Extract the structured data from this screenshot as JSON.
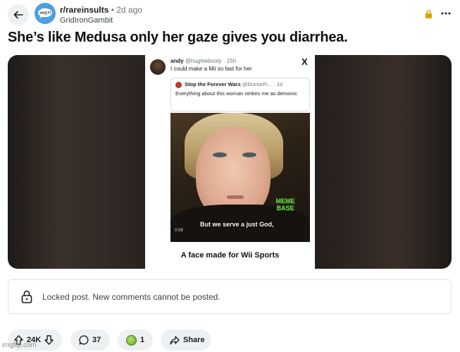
{
  "header": {
    "subreddit": "r/rareinsults",
    "time_ago": "• 2d ago",
    "username": "GridIronGambit",
    "avatar_text": "+#@?!"
  },
  "post": {
    "title": "She’s like Medusa only her gaze gives you diarrhea."
  },
  "meme": {
    "tweet": {
      "display_name": "andy",
      "handle_time": "@hughiebooty · 15h",
      "text": "I could make a Mii so fast for her",
      "platform_icon": "X"
    },
    "quote": {
      "display_name": "Stop the Forever Wars",
      "handle_time": "@DoctorFi... · 1d",
      "text": "Everything about this woman strikes me as demonic"
    },
    "video": {
      "caption": "But we serve a just God,",
      "time": "0:09",
      "watermark": "MEME BASE"
    },
    "caption": "A face made for Wii Sports"
  },
  "locked": {
    "text": "Locked post. New comments cannot be posted."
  },
  "actions": {
    "votes": "24K",
    "comments": "37",
    "awards": "1",
    "share_label": "Share"
  },
  "site_watermark": "imgflip.com",
  "colors": {
    "subreddit_avatar": "#4c9fe0",
    "lock_accent": "#d9a400",
    "pill_bg": "#eef1f3"
  }
}
